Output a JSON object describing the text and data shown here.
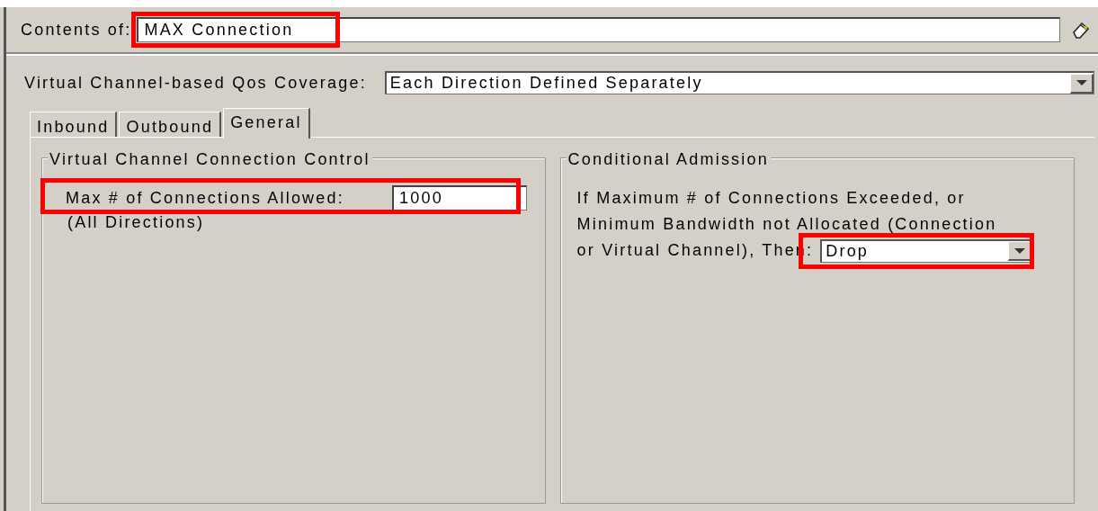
{
  "header": {
    "label": "Contents of:",
    "value": "MAX Connection",
    "highlighted": true
  },
  "coverage": {
    "label": "Virtual Channel-based Qos Coverage:",
    "value": "Each Direction Defined Separately"
  },
  "tabs": [
    {
      "label": "Inbound",
      "selected": false
    },
    {
      "label": "Outbound",
      "selected": false
    },
    {
      "label": "General",
      "selected": true
    }
  ],
  "connection_control": {
    "title": "Virtual Channel Connection Control",
    "label": "Max # of Connections Allowed:",
    "value": "1000",
    "note": "(All Directions)",
    "highlighted": true
  },
  "conditional_admission": {
    "title": "Conditional Admission",
    "lines": [
      "If Maximum # of Connections Exceeded, or",
      "Minimum Bandwidth not Allocated (Connection",
      "or Virtual Channel), Then:"
    ],
    "value": "Drop",
    "highlighted": true
  }
}
